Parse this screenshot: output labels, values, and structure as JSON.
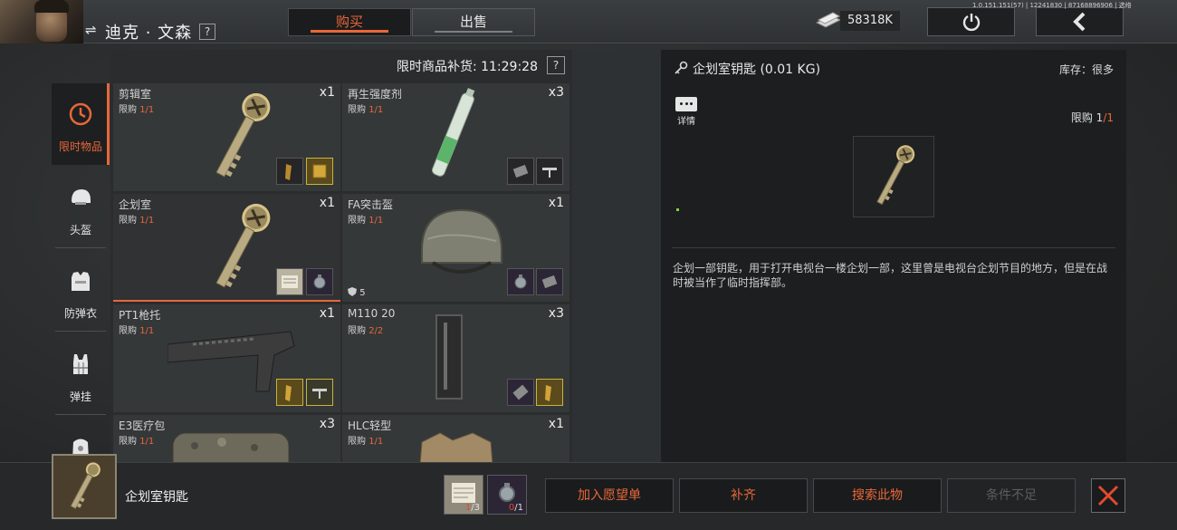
{
  "header": {
    "player_name": "迪克 · 文森",
    "help": "?",
    "tabs": [
      {
        "label": "购买",
        "active": true
      },
      {
        "label": "出售",
        "active": false
      }
    ],
    "money": "58318K",
    "version": "1.0.151.151(57) | 12241830 | 87168896906 | 选络"
  },
  "accent_color": "#e8673a",
  "categories": [
    {
      "label": "限时物品",
      "icon": "clock-icon",
      "active": true
    },
    {
      "label": "头盔",
      "icon": "helmet-icon",
      "active": false
    },
    {
      "label": "防弹衣",
      "icon": "vest-icon",
      "active": false
    },
    {
      "label": "弹挂",
      "icon": "chest-rig-icon",
      "active": false
    },
    {
      "label": "",
      "icon": "backpack-icon",
      "active": false
    }
  ],
  "grid": {
    "restock_label": "限时商品补货: 11:29:28",
    "help": "?",
    "items": [
      {
        "name": "剪辑室",
        "limit_prefix": "限购",
        "limit": "1/1",
        "qty": "x1",
        "icon": "key-icon"
      },
      {
        "name": "再生强度剂",
        "limit_prefix": "限购",
        "limit": "1/1",
        "qty": "x3",
        "icon": "injector-icon"
      },
      {
        "name": "企划室",
        "limit_prefix": "限购",
        "limit": "1/1",
        "qty": "x1",
        "icon": "key-icon",
        "selected": true
      },
      {
        "name": "FA突击盔",
        "limit_prefix": "限购",
        "limit": "1/1",
        "qty": "x1",
        "icon": "helmet-icon",
        "armor_level": "5"
      },
      {
        "name": "PT1枪托",
        "limit_prefix": "限购",
        "limit": "1/1",
        "qty": "x1",
        "icon": "stock-icon"
      },
      {
        "name": "M110 20",
        "limit_prefix": "限购",
        "limit": "2/2",
        "qty": "x3",
        "icon": "magazine-icon"
      },
      {
        "name": "E3医疗包",
        "limit_prefix": "限购",
        "limit": "1/1",
        "qty": "x3",
        "icon": "medkit-icon"
      },
      {
        "name": "HLC轻型",
        "limit_prefix": "限购",
        "limit": "1/1",
        "qty": "x1",
        "icon": "vest-icon"
      }
    ]
  },
  "detail": {
    "title": "企划室钥匙 (0.01 KG)",
    "stock": "库存：很多",
    "details_label": "详情",
    "limit_prefix": "限购",
    "limit_have": "1",
    "limit_total": "/1",
    "description": "企划一部钥匙，用于打开电视台一楼企划一部，这里曾是电视台企划节目的地方，但是在战时被当作了临时指挥部。"
  },
  "bottom": {
    "selected_name": "企划室钥匙",
    "requirements": [
      {
        "icon": "document-icon",
        "have": "1",
        "need": "/3"
      },
      {
        "icon": "grenade-icon",
        "have": "0",
        "need": "/1"
      }
    ],
    "actions": [
      {
        "label": "加入愿望单",
        "enabled": true
      },
      {
        "label": "补齐",
        "enabled": true
      },
      {
        "label": "搜索此物",
        "enabled": true
      },
      {
        "label": "条件不足",
        "enabled": false
      }
    ]
  }
}
